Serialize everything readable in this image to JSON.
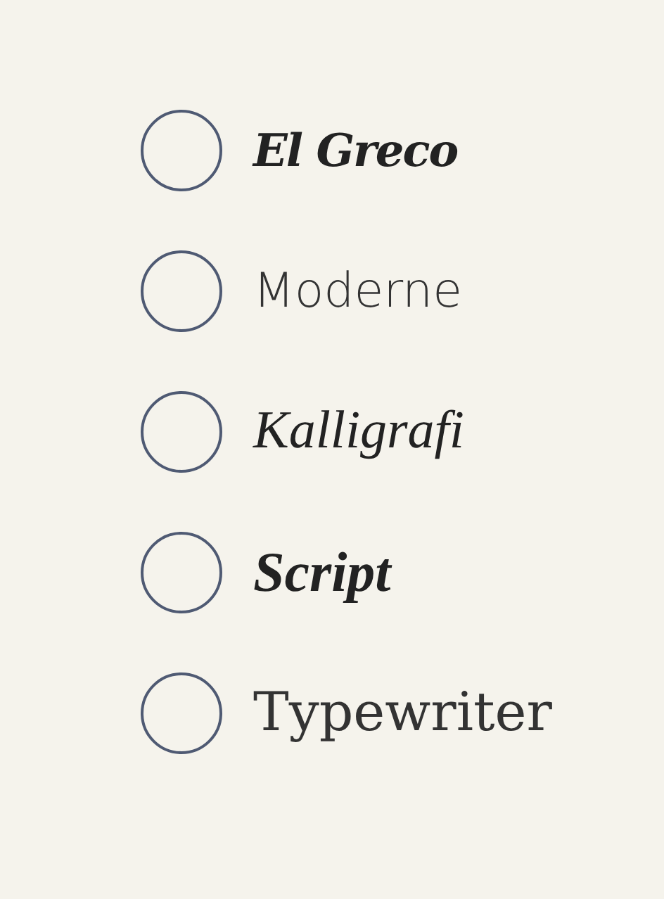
{
  "options": [
    {
      "label": "El Greco",
      "kind": "greco",
      "selected": false
    },
    {
      "label": "Moderne",
      "kind": "moderne",
      "selected": false
    },
    {
      "label": "Kalligrafi",
      "kind": "calligraphy",
      "selected": false
    },
    {
      "label": "Script",
      "kind": "script",
      "selected": false
    },
    {
      "label": "Typewriter",
      "kind": "typewriter",
      "selected": false
    }
  ]
}
